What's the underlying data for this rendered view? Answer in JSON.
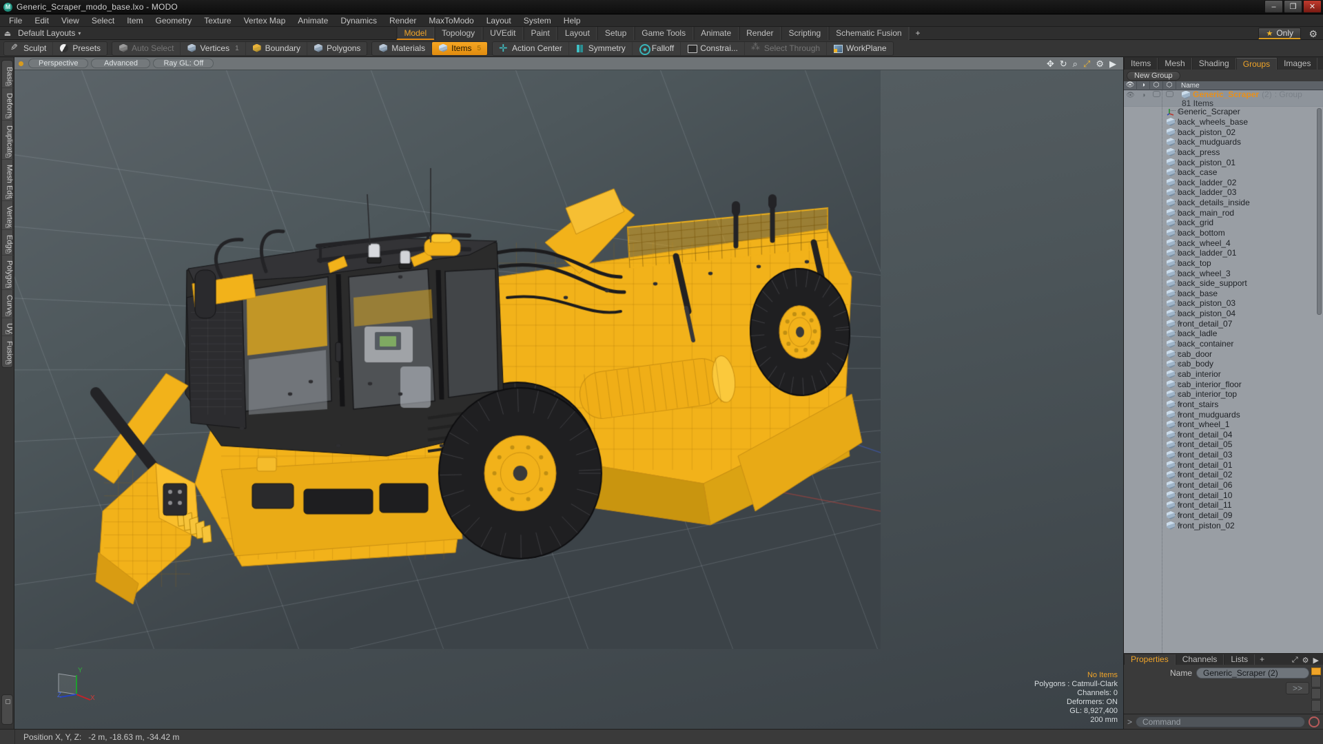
{
  "titlebar": {
    "title": "Generic_Scraper_modo_base.lxo - MODO",
    "logo": "modo-logo-icon",
    "minimize": "–",
    "maximize": "❐",
    "close": "✕"
  },
  "menubar": {
    "items": [
      "File",
      "Edit",
      "View",
      "Select",
      "Item",
      "Geometry",
      "Texture",
      "Vertex Map",
      "Animate",
      "Dynamics",
      "Render",
      "MaxToModo",
      "Layout",
      "System",
      "Help"
    ]
  },
  "layoutrow": {
    "layout_label": "Default Layouts",
    "caret": "▾",
    "tabs": [
      {
        "label": "Model",
        "active": true
      },
      {
        "label": "Topology",
        "active": false
      },
      {
        "label": "UVEdit",
        "active": false
      },
      {
        "label": "Paint",
        "active": false
      },
      {
        "label": "Layout",
        "active": false
      },
      {
        "label": "Setup",
        "active": false
      },
      {
        "label": "Game Tools",
        "active": false
      },
      {
        "label": "Animate",
        "active": false
      },
      {
        "label": "Render",
        "active": false
      },
      {
        "label": "Scripting",
        "active": false
      },
      {
        "label": "Schematic Fusion",
        "active": false
      },
      {
        "label": "+",
        "active": false
      }
    ],
    "only_label": "Only",
    "star": "★",
    "gear": "⚙"
  },
  "toolbar": {
    "groups": [
      {
        "items": [
          {
            "label": "Sculpt",
            "icon": "pencil",
            "state": "normal",
            "count": ""
          },
          {
            "label": "Presets",
            "icon": "sphere",
            "state": "normal",
            "count": ""
          }
        ]
      },
      {
        "items": [
          {
            "label": "Auto Select",
            "icon": "cubegray",
            "state": "dim",
            "count": ""
          },
          {
            "label": "Vertices",
            "icon": "cube",
            "state": "normal",
            "count": "1"
          },
          {
            "label": "Boundary",
            "icon": "cubeyel",
            "state": "normal",
            "count": ""
          },
          {
            "label": "Polygons",
            "icon": "cube",
            "state": "normal",
            "count": ""
          }
        ]
      },
      {
        "items": [
          {
            "label": "Materials",
            "icon": "cube",
            "state": "normal",
            "count": ""
          },
          {
            "label": "Items",
            "icon": "cubeorange",
            "state": "active",
            "count": "5"
          }
        ]
      },
      {
        "items": [
          {
            "label": "Action Center",
            "icon": "crosshair",
            "state": "normal",
            "count": ""
          },
          {
            "label": "Symmetry",
            "icon": "sym",
            "state": "normal",
            "count": ""
          },
          {
            "label": "Falloff",
            "icon": "falloff",
            "state": "normal",
            "count": ""
          },
          {
            "label": "Constrai...",
            "icon": "screen",
            "state": "normal",
            "count": ""
          },
          {
            "label": "Select Through",
            "icon": "dots",
            "state": "dim",
            "count": ""
          },
          {
            "label": "WorkPlane",
            "icon": "wplane",
            "state": "normal",
            "count": ""
          }
        ]
      }
    ]
  },
  "vtabs": {
    "items": [
      "Basic",
      "Deform",
      "Duplicate",
      "Mesh Edit",
      "Vertex",
      "Edge",
      "Polygon",
      "Curve",
      "UV",
      "Fusion"
    ]
  },
  "viewport": {
    "header": {
      "pills": [
        "Perspective",
        "Advanced",
        "Ray GL: Off"
      ],
      "right_icons": [
        "move-icon",
        "rotate-icon",
        "zoom-icon",
        "fit-icon",
        "gear-icon",
        "chevron-right-icon"
      ]
    },
    "stats": {
      "selection": "No Items",
      "polygons": "Polygons : Catmull-Clark",
      "channels": "Channels: 0",
      "deformers": "Deformers: ON",
      "gl": "GL: 8,927,400",
      "grid": "200 mm"
    },
    "axis": {
      "x": "X",
      "y": "Y",
      "z": "Z"
    },
    "model_colors": {
      "body": "#f2b21a",
      "dark": "#2b2b2b",
      "wire": "#c98f12"
    }
  },
  "rightpanel": {
    "tabs": [
      {
        "label": "Items",
        "active": false
      },
      {
        "label": "Mesh ...",
        "active": false
      },
      {
        "label": "Shading",
        "active": false
      },
      {
        "label": "Groups",
        "active": true
      },
      {
        "label": "Images",
        "active": false
      },
      {
        "label": "+",
        "active": false
      }
    ],
    "tab_right_icons": [
      "expand-icon",
      "chevron-right-icon"
    ],
    "new_group_label": "New Group",
    "list_header": {
      "cols": [
        "eye-icon",
        "render-icon",
        "cube-icon-1",
        "cube-icon-2"
      ],
      "name": "Name"
    },
    "group": {
      "name": "Generic_Scraper",
      "index": "(2)",
      "type": ": Group",
      "count": "81 Items"
    },
    "items": [
      "Generic_Scraper",
      "back_wheels_base",
      "back_piston_02",
      "back_mudguards",
      "back_press",
      "back_piston_01",
      "back_case",
      "back_ladder_02",
      "back_ladder_03",
      "back_details_inside",
      "back_main_rod",
      "back_grid",
      "back_bottom",
      "back_wheel_4",
      "back_ladder_01",
      "back_top",
      "back_wheel_3",
      "back_side_support",
      "back_base",
      "back_piston_03",
      "back_piston_04",
      "front_detail_07",
      "back_ladle",
      "back_container",
      "cab_door",
      "cab_body",
      "cab_interior",
      "cab_interior_floor",
      "cab_interior_top",
      "front_stairs",
      "front_mudguards",
      "front_wheel_1",
      "front_detail_04",
      "front_detail_05",
      "front_detail_03",
      "front_detail_01",
      "front_detail_02",
      "front_detail_06",
      "front_detail_10",
      "front_detail_11",
      "front_detail_09",
      "front_piston_02"
    ]
  },
  "properties": {
    "tabs": [
      {
        "label": "Properties",
        "active": true
      },
      {
        "label": "Channels",
        "active": false
      },
      {
        "label": "Lists",
        "active": false
      },
      {
        "label": "+",
        "active": false
      }
    ],
    "tab_right_icons": [
      "expand-icon",
      "gear-icon",
      "chevron-right-icon"
    ],
    "name_label": "Name",
    "name_value": "Generic_Scraper (2)",
    "more_button": ">>"
  },
  "commandbar": {
    "prompt": ">",
    "placeholder": "Command"
  },
  "statusbar": {
    "position_label": "Position X, Y, Z:",
    "position_value": "-2 m, -18.63 m, -34.42 m"
  }
}
